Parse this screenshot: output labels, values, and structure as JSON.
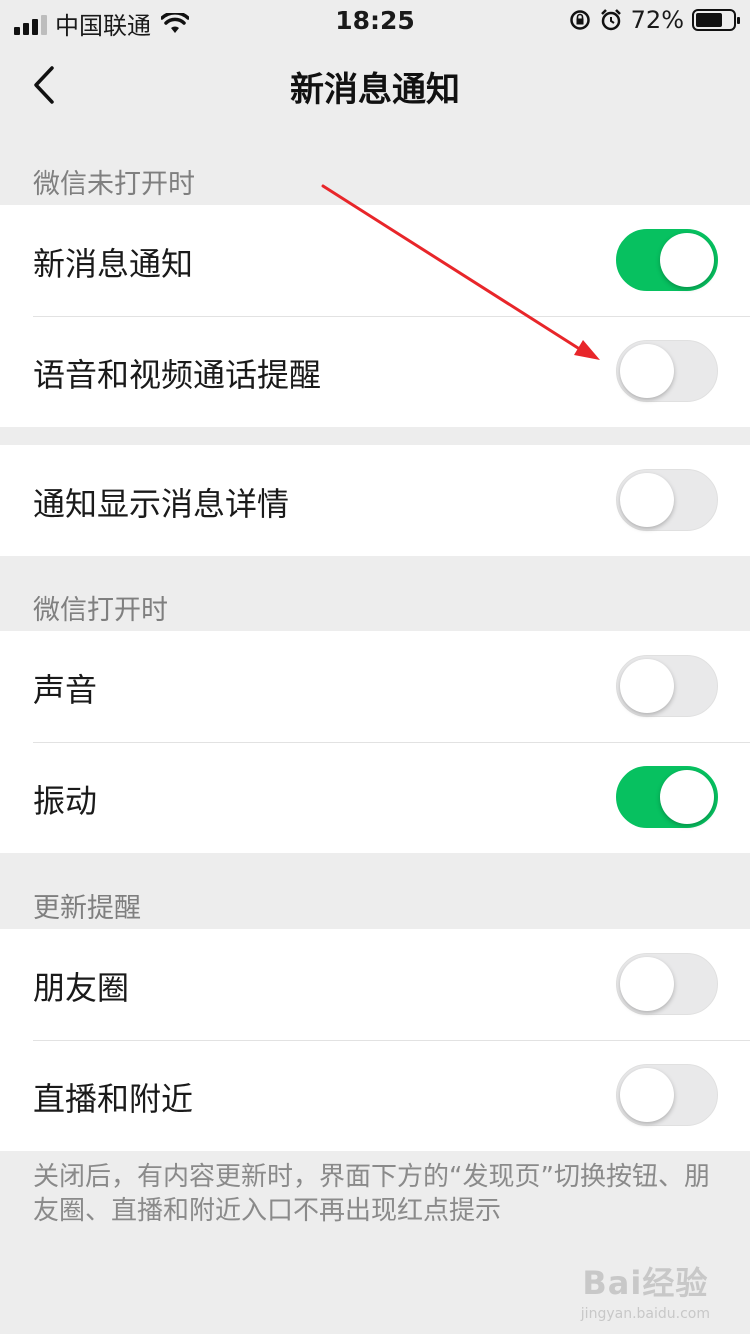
{
  "status_bar": {
    "carrier": "中国联通",
    "time": "18:25",
    "battery_percent": "72%",
    "battery_level": 0.72
  },
  "nav": {
    "title": "新消息通知",
    "back_icon": "chevron-left-icon"
  },
  "sections": [
    {
      "label": "微信未打开时"
    },
    {
      "label": "微信打开时"
    },
    {
      "label": "更新提醒"
    }
  ],
  "rows": {
    "new_message": {
      "label": "新消息通知",
      "on": true
    },
    "voice_video": {
      "label": "语音和视频通话提醒",
      "on": false
    },
    "show_details": {
      "label": "通知显示消息详情",
      "on": false
    },
    "sound": {
      "label": "声音",
      "on": false
    },
    "vibrate": {
      "label": "振动",
      "on": true
    },
    "moments": {
      "label": "朋友圈",
      "on": false
    },
    "live_nearby": {
      "label": "直播和附近",
      "on": false
    }
  },
  "footer_note": "关闭后，有内容更新时，界面下方的“发现页”切换按钮、朋友圈、直播和附近入口不再出现红点提示",
  "watermark": {
    "logo": "Bai经验",
    "sub": "jingyan.baidu.com"
  },
  "colors": {
    "toggle_on": "#07c160",
    "toggle_off": "#e9e9ea",
    "annotation_arrow": "#e8262a"
  }
}
